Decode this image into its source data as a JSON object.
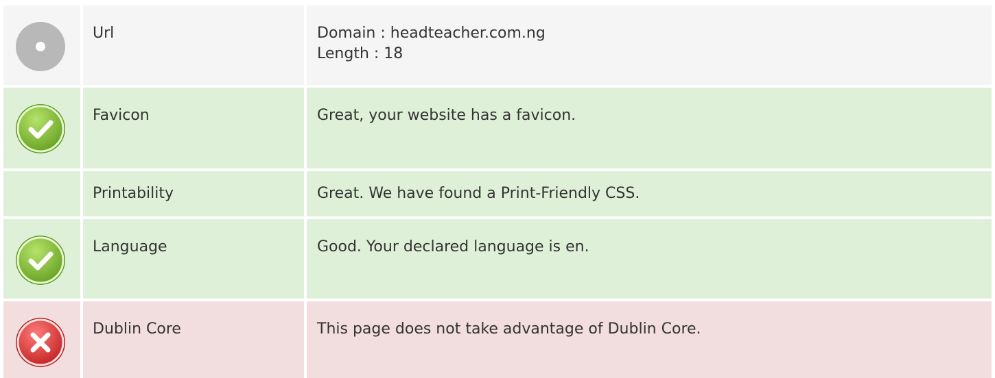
{
  "rows": [
    {
      "status": "neutral",
      "icon": "info-neutral-icon",
      "label": "Url",
      "value_lines": [
        "Domain : headteacher.com.ng",
        "Length : 18"
      ]
    },
    {
      "status": "good",
      "icon": "check-circle-icon",
      "label": "Favicon",
      "value": "Great, your website has a favicon."
    },
    {
      "status": "good",
      "label": "Printability",
      "value": "Great. We have found a Print-Friendly CSS."
    },
    {
      "status": "good",
      "icon": "check-circle-icon",
      "label": "Language",
      "value": "Good. Your declared language is en."
    },
    {
      "status": "bad",
      "icon": "error-circle-icon",
      "label": "Dublin Core",
      "value": "This page does not take advantage of Dublin Core."
    }
  ],
  "colors": {
    "neutral_bg": "#f5f5f5",
    "good_bg": "#dff0d8",
    "bad_bg": "#f2dede",
    "good_icon": "#8cc63f",
    "bad_icon": "#e04040",
    "neutral_icon": "#b8b8b8"
  }
}
